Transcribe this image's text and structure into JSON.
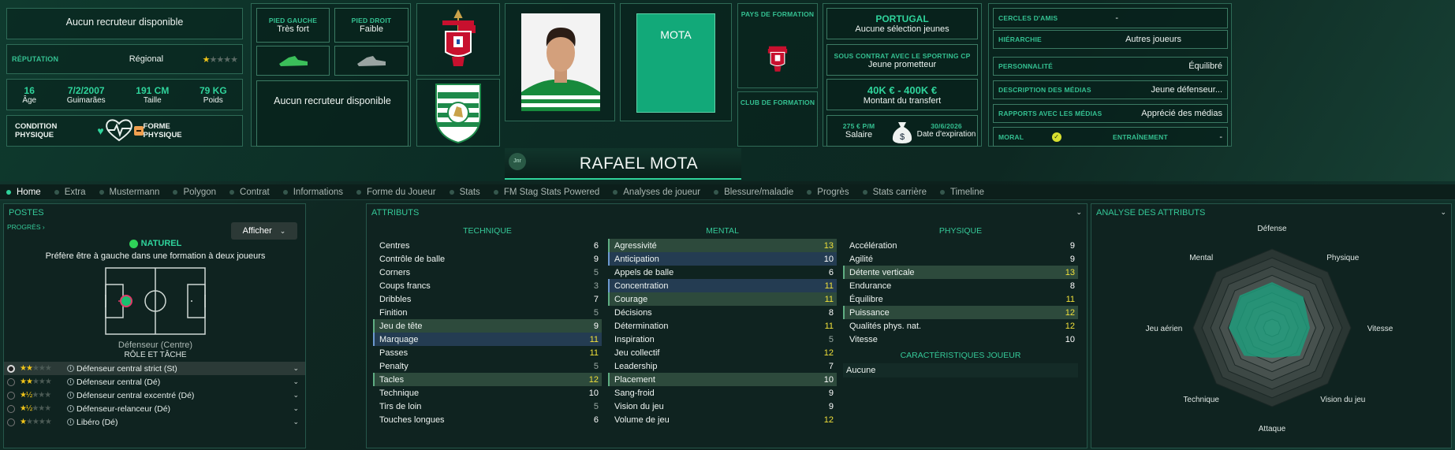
{
  "top": {
    "recruiter1": "Aucun recruteur disponible",
    "reputation": {
      "label": "RÉPUTATION",
      "value": "Régional",
      "stars": 1.5
    },
    "bio": [
      {
        "value": "16",
        "label": "Âge"
      },
      {
        "value": "7/2/2007",
        "label": "Guimarães"
      },
      {
        "value": "191 CM",
        "label": "Taille"
      },
      {
        "value": "79 KG",
        "label": "Poids"
      }
    ],
    "condition_label": "CONDITION PHYSIQUE",
    "form_label": "FORME PHYSIQUE",
    "left_foot": {
      "label": "PIED GAUCHE",
      "value": "Très fort"
    },
    "right_foot": {
      "label": "PIED DROIT",
      "value": "Faible"
    },
    "recruiter2": "Aucun recruteur disponible",
    "player_name": "RAFAEL MOTA",
    "shirt_name": "MOTA",
    "avatar_initials": "Jnr",
    "country_training_label": "PAYS DE FORMATION",
    "club_training_label": "CLUB DE FORMATION",
    "nation": "PORTUGAL",
    "nation_sub": "Aucune sélection jeunes",
    "contract_label": "SOUS CONTRAT AVEC LE SPORTING CP",
    "contract_value": "Jeune prometteur",
    "transfer_value": "40K € - 400K €",
    "transfer_label": "Montant du transfert",
    "salary_value": "275 € P/M",
    "salary_label": "Salaire",
    "expiry_value": "30/6/2026",
    "expiry_label": "Date d'expiration",
    "right": [
      {
        "label": "CERCLES D'AMIS",
        "value": "-"
      },
      {
        "label": "HIÉRARCHIE",
        "value": "Autres joueurs"
      },
      {
        "label": "PERSONNALITÉ",
        "value": "Équilibré"
      },
      {
        "label": "DESCRIPTION DES MÉDIAS",
        "value": "Jeune défenseur..."
      },
      {
        "label": "RAPPORTS AVEC LES MÉDIAS",
        "value": "Apprécié des médias"
      }
    ],
    "morale_label": "MORAL",
    "training_label": "ENTRAÎNEMENT",
    "training_value": "-"
  },
  "tabs": [
    "Home",
    "Extra",
    "Mustermann",
    "Polygon",
    "Contrat",
    "Informations",
    "Forme du Joueur",
    "Stats",
    "FM Stag Stats Powered",
    "Analyses de joueur",
    "Blessure/maladie",
    "Progrès",
    "Stats carrière",
    "Timeline"
  ],
  "positions": {
    "title": "POSTES",
    "progress": "PROGRÈS",
    "show_button": "Afficher",
    "natural": "NATUREL",
    "pref": "Préfère être à gauche dans une formation à deux joueurs",
    "position": "Défenseur (Centre)",
    "role_title": "RÔLE ET TÂCHE",
    "roles": [
      {
        "name": "Défenseur central strict (St)",
        "stars": 2
      },
      {
        "name": "Défenseur central (Dé)",
        "stars": 2
      },
      {
        "name": "Défenseur central excentré (Dé)",
        "stars": 1.5
      },
      {
        "name": "Défenseur-relanceur (Dé)",
        "stars": 1.5
      },
      {
        "name": "Libéro (Dé)",
        "stars": 1
      }
    ]
  },
  "attributes": {
    "title": "ATTRIBUTS",
    "technical_title": "TECHNIQUE",
    "mental_title": "MENTAL",
    "physical_title": "PHYSIQUE",
    "technical": [
      {
        "n": "Centres",
        "v": 6,
        "c": "w"
      },
      {
        "n": "Contrôle de balle",
        "v": 9,
        "c": "w"
      },
      {
        "n": "Corners",
        "v": 5,
        "c": "g"
      },
      {
        "n": "Coups francs",
        "v": 3,
        "c": "g"
      },
      {
        "n": "Dribbles",
        "v": 7,
        "c": "w"
      },
      {
        "n": "Finition",
        "v": 5,
        "c": "g"
      },
      {
        "n": "Jeu de tête",
        "v": 9,
        "c": "w",
        "h": "hl"
      },
      {
        "n": "Marquage",
        "v": 11,
        "c": "y",
        "h": "hb"
      },
      {
        "n": "Passes",
        "v": 11,
        "c": "y"
      },
      {
        "n": "Penalty",
        "v": 5,
        "c": "g"
      },
      {
        "n": "Tacles",
        "v": 12,
        "c": "y",
        "h": "hl"
      },
      {
        "n": "Technique",
        "v": 10,
        "c": "w"
      },
      {
        "n": "Tirs de loin",
        "v": 5,
        "c": "g"
      },
      {
        "n": "Touches longues",
        "v": 6,
        "c": "w"
      }
    ],
    "mental": [
      {
        "n": "Agressivité",
        "v": 13,
        "c": "y",
        "h": "hl"
      },
      {
        "n": "Anticipation",
        "v": 10,
        "c": "w",
        "h": "hb"
      },
      {
        "n": "Appels de balle",
        "v": 6,
        "c": "w"
      },
      {
        "n": "Concentration",
        "v": 11,
        "c": "y",
        "h": "hb"
      },
      {
        "n": "Courage",
        "v": 11,
        "c": "y",
        "h": "hl"
      },
      {
        "n": "Décisions",
        "v": 8,
        "c": "w"
      },
      {
        "n": "Détermination",
        "v": 11,
        "c": "y"
      },
      {
        "n": "Inspiration",
        "v": 5,
        "c": "g"
      },
      {
        "n": "Jeu collectif",
        "v": 12,
        "c": "y"
      },
      {
        "n": "Leadership",
        "v": 7,
        "c": "w"
      },
      {
        "n": "Placement",
        "v": 10,
        "c": "w",
        "h": "hl"
      },
      {
        "n": "Sang-froid",
        "v": 9,
        "c": "w"
      },
      {
        "n": "Vision du jeu",
        "v": 9,
        "c": "w"
      },
      {
        "n": "Volume de jeu",
        "v": 12,
        "c": "y"
      }
    ],
    "physical": [
      {
        "n": "Accélération",
        "v": 9,
        "c": "w"
      },
      {
        "n": "Agilité",
        "v": 9,
        "c": "w"
      },
      {
        "n": "Détente verticale",
        "v": 13,
        "c": "y",
        "h": "hl"
      },
      {
        "n": "Endurance",
        "v": 8,
        "c": "w"
      },
      {
        "n": "Équilibre",
        "v": 11,
        "c": "y"
      },
      {
        "n": "Puissance",
        "v": 12,
        "c": "y",
        "h": "hl"
      },
      {
        "n": "Qualités phys. nat.",
        "v": 12,
        "c": "y"
      },
      {
        "n": "Vitesse",
        "v": 10,
        "c": "w"
      }
    ],
    "traits_title": "CARACTÉRISTIQUES JOUEUR",
    "traits_value": "Aucune"
  },
  "analysis": {
    "title": "ANALYSE DES ATTRIBUTS",
    "axes": [
      "Défense",
      "Physique",
      "Vitesse",
      "Vision du jeu",
      "Attaque",
      "Technique",
      "Jeu aérien",
      "Mental"
    ]
  },
  "colors": {
    "accent": "#2fd39b",
    "panel": "#0f2320",
    "highlight_green": "#2d4a3c",
    "highlight_blue": "#243c52"
  }
}
